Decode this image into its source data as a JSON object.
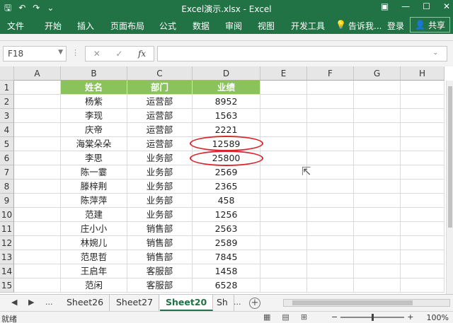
{
  "window": {
    "title": "Excel演示.xlsx - Excel",
    "qat": [
      "save-icon",
      "undo-icon",
      "redo-icon",
      "customize-icon"
    ],
    "qat_glyphs": [
      "🖫",
      "↶",
      "↷",
      "⌄"
    ],
    "controls": [
      "▣",
      "—",
      "☐",
      "✕"
    ]
  },
  "ribbon": {
    "tabs": [
      "文件",
      "开始",
      "插入",
      "页面布局",
      "公式",
      "数据",
      "审阅",
      "视图",
      "开发工具",
      "告诉我..."
    ],
    "tell_me_icon": "💡",
    "login": "登录",
    "share": "共享",
    "share_icon": "👤"
  },
  "formula_bar": {
    "name_box": "F18",
    "dropdown": "▼",
    "dots": "⋮",
    "cancel": "✕",
    "confirm": "✓",
    "fx": "fx",
    "value": "",
    "expand": "⌄"
  },
  "grid": {
    "columns": [
      "A",
      "B",
      "C",
      "D",
      "E",
      "F",
      "G",
      "H"
    ],
    "rows": [
      "1",
      "2",
      "3",
      "4",
      "5",
      "6",
      "7",
      "8",
      "9",
      "10",
      "11",
      "12",
      "13",
      "14",
      "15"
    ],
    "header": [
      "姓名",
      "部门",
      "业绩"
    ],
    "data": [
      [
        "杨紫",
        "运营部",
        "8952"
      ],
      [
        "李现",
        "运营部",
        "1563"
      ],
      [
        "庆帝",
        "运营部",
        "2221"
      ],
      [
        "海棠朵朵",
        "运营部",
        "12589"
      ],
      [
        "李思",
        "业务部",
        "25800"
      ],
      [
        "陈一霎",
        "业务部",
        "2569"
      ],
      [
        "滕梓荆",
        "业务部",
        "2365"
      ],
      [
        "陈萍萍",
        "业务部",
        "458"
      ],
      [
        "范建",
        "业务部",
        "1256"
      ],
      [
        "庄小小",
        "销售部",
        "2563"
      ],
      [
        "林婉儿",
        "销售部",
        "2589"
      ],
      [
        "范思哲",
        "销售部",
        "7845"
      ],
      [
        "王启年",
        "客服部",
        "1458"
      ],
      [
        "范闲",
        "客服部",
        "6528"
      ]
    ],
    "header_color": "#8ac35c",
    "highlight_color": "#d9262e",
    "cursor": "⇱"
  },
  "sheets": {
    "nav": [
      "◀",
      "▶",
      "..."
    ],
    "tabs": [
      "Sheet26",
      "Sheet27",
      "Sheet20",
      "Sh"
    ],
    "active": "Sheet20",
    "more": "...",
    "add": "+"
  },
  "status": {
    "ready": "就绪",
    "views": [
      "▦",
      "▤",
      "⊞"
    ],
    "zoom_minus": "−",
    "zoom_plus": "+",
    "zoom": "100%"
  },
  "accent": "#217346"
}
